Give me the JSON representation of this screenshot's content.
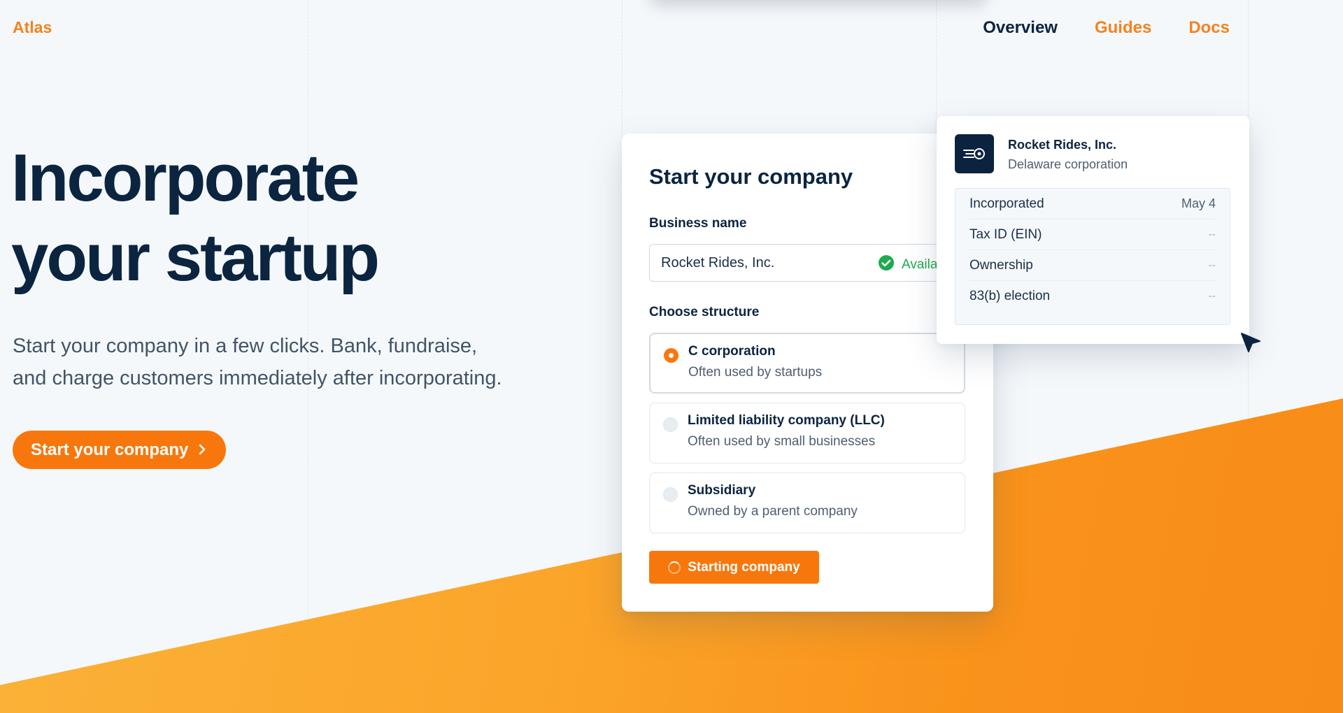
{
  "brand": {
    "name": "Atlas",
    "accent": "#f7770d",
    "navy": "#0b2440"
  },
  "nav": {
    "items": [
      {
        "label": "Overview",
        "active": true
      },
      {
        "label": "Guides",
        "active": false
      },
      {
        "label": "Docs",
        "active": false
      }
    ]
  },
  "hero": {
    "title_line1": "Incorporate",
    "title_line2": "your startup",
    "subtitle_line1": "Start your company in a few clicks. Bank, fundraise,",
    "subtitle_line2": "and charge customers immediately after incorporating.",
    "cta_label": "Start your company",
    "cta_icon": "chevron-right-icon"
  },
  "form": {
    "title": "Start your company",
    "business_name_label": "Business name",
    "business_name_value": "Rocket Rides, Inc.",
    "availability_text": "Availa",
    "structure_label": "Choose structure",
    "options": [
      {
        "title": "C corporation",
        "description": "Often used by startups",
        "selected": true
      },
      {
        "title": "Limited liability company (LLC)",
        "description": "Often used by small businesses",
        "selected": false
      },
      {
        "title": "Subsidiary",
        "description": "Owned by a parent company",
        "selected": false
      }
    ],
    "submit_label": "Starting company"
  },
  "company": {
    "name": "Rocket Rides, Inc.",
    "type": "Delaware corporation",
    "logo_icon": "rocket-speed-icon",
    "rows": [
      {
        "key": "Incorporated",
        "value": "May 4"
      },
      {
        "key": "Tax ID (EIN)",
        "value": "--"
      },
      {
        "key": "Ownership",
        "value": "--"
      },
      {
        "key": "83(b) election",
        "value": "--"
      }
    ]
  }
}
